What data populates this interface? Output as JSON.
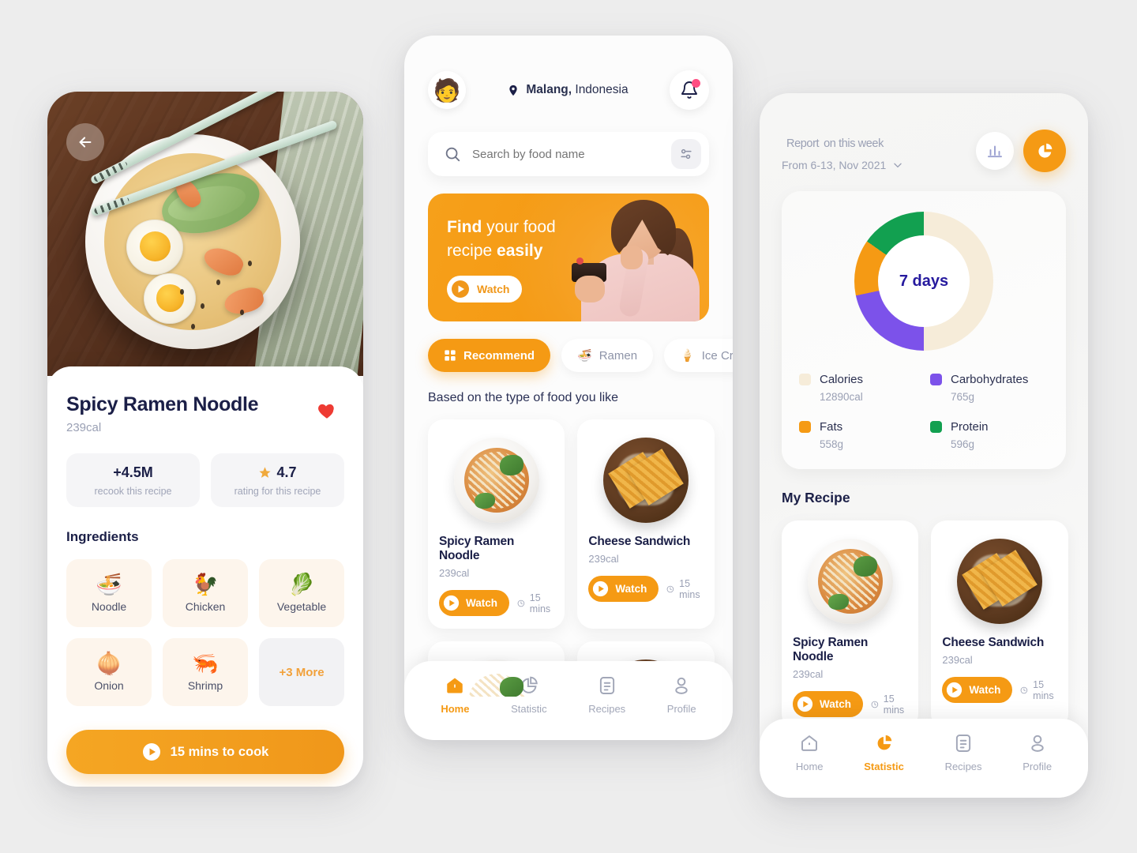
{
  "background": "#ededed",
  "accent": "#f59a14",
  "detail_screen": {
    "name": "recipe-detail",
    "back_icon": "arrow-left-icon",
    "title": "Spicy Ramen Noodle",
    "calories": "239cal",
    "favorite_icon": "heart-icon",
    "stats": [
      {
        "value": "+4.5M",
        "label": "recook this recipe",
        "icon": ""
      },
      {
        "value": "4.7",
        "label": "rating for this recipe",
        "icon": "star-icon"
      }
    ],
    "ingredients_title": "Ingredients",
    "ingredients": [
      {
        "emoji": "🍜",
        "name": "Noodle"
      },
      {
        "emoji": "🐓",
        "name": "Chicken"
      },
      {
        "emoji": "🥬",
        "name": "Vegetable"
      },
      {
        "emoji": "🧅",
        "name": "Onion"
      },
      {
        "emoji": "🦐",
        "name": "Shrimp"
      }
    ],
    "more_label": "+3 More",
    "cook_button": "15 mins to cook",
    "cook_button_icon": "play-circle-icon"
  },
  "home_screen": {
    "name": "home",
    "avatar_emoji": "🧑",
    "location_icon": "map-pin-icon",
    "location_city": "Malang,",
    "location_country": " Indonesia",
    "bell_icon": "bell-icon",
    "search": {
      "icon": "search-icon",
      "placeholder": "Search by food name",
      "value": "",
      "filter_icon": "sliders-icon"
    },
    "promo": {
      "line1_strong": "Find",
      "line1_rest": " your food",
      "line2_rest": "recipe ",
      "line2_strong": "easily",
      "button_label": "Watch",
      "button_icon": "play-icon"
    },
    "chips": [
      {
        "icon": "grid-icon",
        "label": "Recommend",
        "active": true
      },
      {
        "icon": "🍜",
        "label": "Ramen",
        "active": false
      },
      {
        "icon": "🍦",
        "label": "Ice Cream",
        "active": false
      }
    ],
    "section_title": "Based on the type of food you like",
    "cards": [
      {
        "name": "Spicy Ramen Noodle",
        "calories": "239cal",
        "watch": "Watch",
        "mins": "15 mins",
        "art": "ramen"
      },
      {
        "name": "Cheese Sandwich",
        "calories": "239cal",
        "watch": "Watch",
        "mins": "15 mins",
        "art": "sandwich"
      }
    ],
    "nav": [
      {
        "icon": "home-icon",
        "label": "Home",
        "active": true
      },
      {
        "icon": "pie-chart-icon",
        "label": "Statistic",
        "active": false
      },
      {
        "icon": "document-icon",
        "label": "Recipes",
        "active": false
      },
      {
        "icon": "person-icon",
        "label": "Profile",
        "active": false
      }
    ]
  },
  "report_screen": {
    "name": "statistic-report",
    "title": "Report",
    "title_suffix": "on this week",
    "date_range": "From 6-13, Nov 2021",
    "date_chevron_icon": "chevron-down-icon",
    "bar_chart_icon": "bar-chart-icon",
    "pie_chart_icon": "pie-chart-icon",
    "donut_center": "7 days",
    "my_recipe_title": "My Recipe",
    "cards": [
      {
        "name": "Spicy Ramen Noodle",
        "calories": "239cal",
        "watch": "Watch",
        "mins": "15 mins",
        "art": "ramen"
      },
      {
        "name": "Cheese Sandwich",
        "calories": "239cal",
        "watch": "Watch",
        "mins": "15 mins",
        "art": "sandwich"
      }
    ],
    "nav": [
      {
        "icon": "home-icon",
        "label": "Home",
        "active": false
      },
      {
        "icon": "pie-chart-icon",
        "label": "Statistic",
        "active": true
      },
      {
        "icon": "document-icon",
        "label": "Recipes",
        "active": false
      },
      {
        "icon": "person-icon",
        "label": "Profile",
        "active": false
      }
    ]
  },
  "chart_data": {
    "type": "pie",
    "title": "Report on this week",
    "center_label": "7 days",
    "categories": [
      "Calories",
      "Carbohydrates",
      "Fats",
      "Protein"
    ],
    "values": [
      12890,
      765,
      558,
      596
    ],
    "value_labels": [
      "12890cal",
      "765g",
      "558g",
      "596g"
    ],
    "colors": [
      "#f6ecd9",
      "#7c52ea",
      "#f59a14",
      "#12a050"
    ],
    "sweep_degrees": [
      180,
      78,
      47,
      55
    ],
    "legend_position": "below",
    "donut": true
  }
}
